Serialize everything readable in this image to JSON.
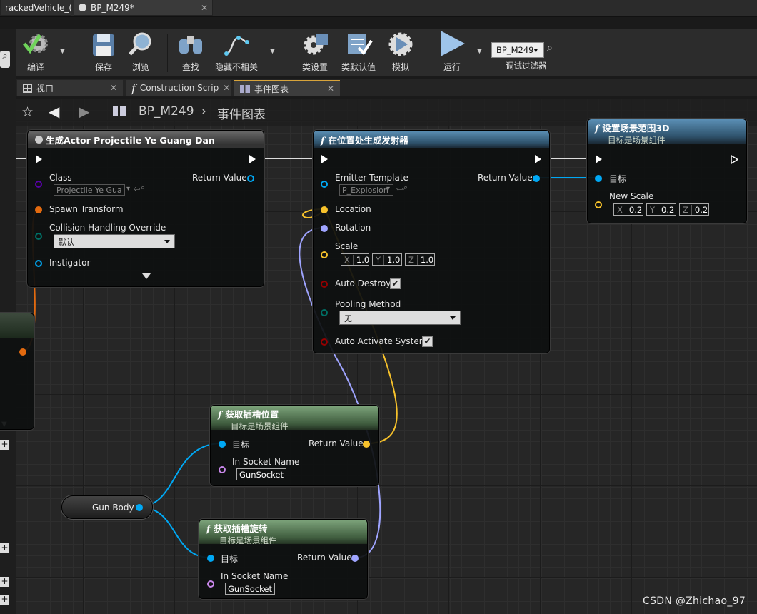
{
  "tabs": [
    {
      "label": "rackedVehicle_("
    },
    {
      "label": "BP_M249*"
    }
  ],
  "toolbar": {
    "compile": "编译",
    "save": "保存",
    "browse": "浏览",
    "find": "查找",
    "hide_unrelated": "隐藏不相关",
    "class_settings": "类设置",
    "class_defaults": "类默认值",
    "simulate": "模拟",
    "play": "运行",
    "debug_object": "BP_M249▾",
    "debug_filter": "调试过滤器"
  },
  "panel_tabs": [
    {
      "label": "视口"
    },
    {
      "label": "Construction Scrip"
    },
    {
      "label": "事件图表"
    }
  ],
  "breadcrumb": {
    "blueprint": "BP_M249",
    "graph": "事件图表"
  },
  "nodes": {
    "spawn_actor": {
      "title": "生成Actor Projectile Ye Guang Dan",
      "class_label": "Class",
      "class_value": "Projectile Ye Gua",
      "return_value": "Return Value",
      "spawn_transform": "Spawn Transform",
      "collision_label": "Collision Handling Override",
      "collision_value": "默认",
      "instigator": "Instigator"
    },
    "spawn_emitter": {
      "title": "在位置处生成发射器",
      "emitter_label": "Emitter Template",
      "emitter_value": "P_Explosion",
      "return_value": "Return Value",
      "location": "Location",
      "rotation": "Rotation",
      "scale": "Scale",
      "scale_x": "1.0",
      "scale_y": "1.0",
      "scale_z": "1.0",
      "auto_destroy": "Auto Destroy",
      "pooling_label": "Pooling Method",
      "pooling_value": "无",
      "auto_activate": "Auto Activate System"
    },
    "set_scale": {
      "title": "设置场景范围3D",
      "subtitle": "目标是场景组件",
      "target": "目标",
      "new_scale": "New Scale",
      "x": "0.2",
      "y": "0.2",
      "z": "0.2"
    },
    "get_socket_location": {
      "title": "获取插槽位置",
      "subtitle": "目标是场景组件",
      "target": "目标",
      "return_value": "Return Value",
      "socket_label": "In Socket Name",
      "socket_value": "GunSocket"
    },
    "get_socket_rotation": {
      "title": "获取插槽旋转",
      "subtitle": "目标是场景组件",
      "target": "目标",
      "return_value": "Return Value",
      "socket_label": "In Socket Name",
      "socket_value": "GunSocket"
    },
    "gun_body": {
      "label": "Gun Body"
    }
  },
  "axis_labels": {
    "x": "X",
    "y": "Y",
    "z": "Z"
  },
  "colors": {
    "exec": "#ffffff",
    "object_pin": "#00a8f4",
    "vector_pin": "#f7c22b",
    "rotator_pin": "#9fa4ff",
    "transform_pin": "#e36a0f",
    "name_pin": "#c887ea",
    "bool_pin": "#940000",
    "enum_pin": "#006f65",
    "class_pin": "#5800a8"
  },
  "watermark": "CSDN @Zhichao_97"
}
